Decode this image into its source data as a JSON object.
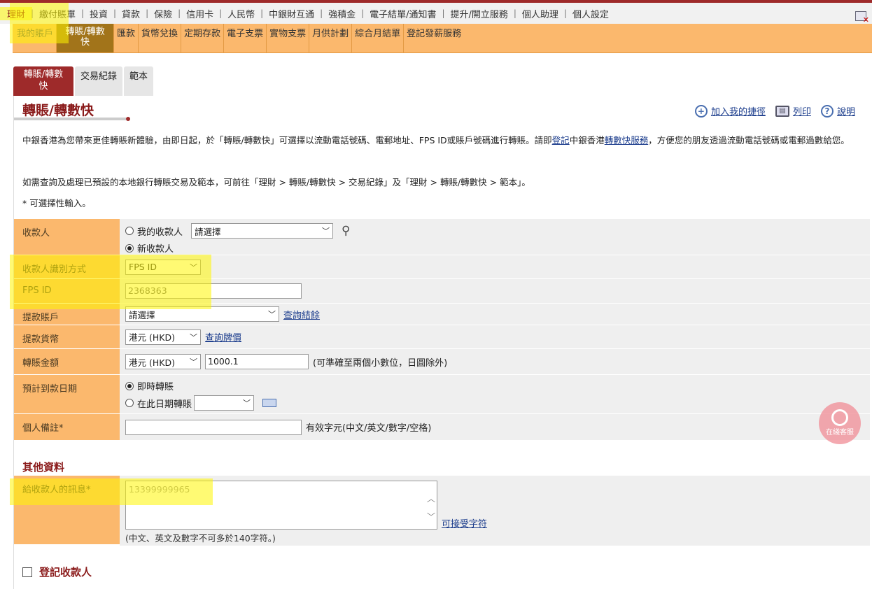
{
  "topnav": [
    "理財",
    "繳付賬單",
    "投資",
    "貸款",
    "保險",
    "信用卡",
    "人民幣",
    "中銀財互通",
    "強積金",
    "電子結單/通知書",
    "提升/開立服務",
    "個人助理",
    "個人設定"
  ],
  "subnav": [
    "我的賬戶",
    "轉賬/轉數快",
    "匯款",
    "貨幣兌換",
    "定期存款",
    "電子支票",
    "實物支票",
    "月供計劃",
    "綜合月結單",
    "登記發薪服務"
  ],
  "tabs": [
    "轉賬/轉數快",
    "交易紀錄",
    "範本"
  ],
  "page_title": "轉賬/轉數快",
  "tools": {
    "add": "加入我的捷徑",
    "print": "列印",
    "help": "說明"
  },
  "intro": {
    "p1a": "中銀香港為您帶來更佳轉賬新體驗，由即日起，於「轉賬/轉數快」可選擇以流動電話號碼、電郵地址、FPS ID或賬戶號碼進行轉賬。請即",
    "p1_link1": "登記",
    "p1b": "中銀香港",
    "p1_link2": "轉數快服務",
    "p1c": "，方便您的朋友透過流動電話號碼或電郵過數給您。",
    "p2": "如需查詢及處理已預設的本地銀行轉賬交易及範本，可前往「理財 > 轉賬/轉數快 > 交易紀錄」及「理財 > 轉賬/轉數快 > 範本」。",
    "p3": "* 可選擇性輸入。"
  },
  "form": {
    "payee_label": "收款人",
    "payee_opt1": "我的收款人",
    "payee_select": "請選擇",
    "payee_opt2": "新收款人",
    "id_method_label": "收款人識別方式",
    "id_method_value": "FPS ID",
    "fps_label": "FPS ID",
    "fps_value": "2368363",
    "account_label": "提款賬戶",
    "account_value": "請選擇",
    "account_link": "查詢結餘",
    "currency_label": "提款貨幣",
    "currency_value": "港元 (HKD)",
    "currency_link": "查詢牌價",
    "amount_label": "轉賬金額",
    "amount_currency": "港元 (HKD)",
    "amount_value": "1000.1",
    "amount_note": "(可準確至兩個小數位，日圓除外)",
    "date_label": "預計到款日期",
    "date_opt1": "即時轉賬",
    "date_opt2": "在此日期轉賬",
    "memo_label": "個人備註*",
    "memo_note": "有效字元(中文/英文/數字/空格)"
  },
  "other": {
    "title": "其他資料",
    "msg_label": "給收款人的訊息*",
    "msg_value": "13399999965",
    "msg_link": "可接受字符",
    "msg_note": "(中文、英文及數字不可多於140字符。)"
  },
  "register_label": "登記收款人",
  "chat_label": "在綫客服"
}
